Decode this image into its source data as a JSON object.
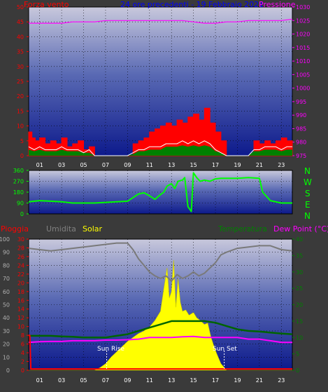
{
  "header": {
    "left_title": "Forza vento",
    "center_title": "24 ore precedenti - 19 Febbraio 2021",
    "right_title": "Pressione"
  },
  "middle": {
    "direction_letters": [
      "N",
      "W",
      "S",
      "E",
      "N"
    ]
  },
  "bottom_header": {
    "pioggia": "Pioggia",
    "umidita": "Umidita",
    "solar": "Solar",
    "temperatura": "Temperatura",
    "dew_point": "Dew Point (°C)"
  },
  "annotations": {
    "sun_rise": "Sun Rise",
    "sun_set": "Sun Set"
  },
  "colors": {
    "wind": "#ff0000",
    "gust": "#008000",
    "pressure": "#ff00ff",
    "direction": "#00ff00",
    "humidity": "#808080",
    "solar": "#ffff00",
    "temperature": "#006400",
    "dew_point": "#ff00ff",
    "rain": "#ff0000",
    "title_blue": "#0000ff",
    "green_label": "#008000"
  },
  "chart_data": [
    {
      "type": "line",
      "title": "24 ore precedenti - 19 Febbraio 2021",
      "x_ticks": [
        "01",
        "03",
        "05",
        "07",
        "09",
        "11",
        "13",
        "15",
        "17",
        "19",
        "21",
        "23"
      ],
      "xlim": [
        0,
        24
      ],
      "left_axis": {
        "label": "Forza vento",
        "ticks": [
          0,
          5,
          10,
          15,
          20,
          25,
          30,
          35,
          40,
          45,
          50
        ],
        "ylim": [
          0,
          50
        ]
      },
      "right_axis": {
        "label": "Pressione",
        "ticks": [
          975,
          980,
          985,
          990,
          995,
          1000,
          1005,
          1010,
          1015,
          1020,
          1025,
          1030
        ],
        "ylim": [
          975,
          1030
        ]
      },
      "series": [
        {
          "name": "Pressione",
          "axis": "right",
          "x": [
            0,
            1,
            2,
            3,
            4,
            5,
            6,
            7,
            8,
            9,
            10,
            11,
            12,
            13,
            14,
            15,
            16,
            17,
            18,
            19,
            20,
            21,
            22,
            23,
            24
          ],
          "y": [
            1024,
            1024,
            1024,
            1024,
            1024.5,
            1024.5,
            1024.5,
            1025,
            1025,
            1025,
            1025,
            1025,
            1025,
            1025,
            1025,
            1024.5,
            1024,
            1024,
            1024.5,
            1024.5,
            1025,
            1025,
            1025,
            1025,
            1025.5
          ]
        },
        {
          "name": "wind_max",
          "axis": "left",
          "x": [
            0,
            0.3,
            0.6,
            1,
            1.5,
            2,
            2.5,
            3,
            3.5,
            4,
            4.5,
            5,
            5.5,
            6,
            7,
            8,
            8.5,
            9,
            9.5,
            10,
            10.5,
            11,
            11.5,
            12,
            12.5,
            13,
            13.5,
            14,
            14.5,
            15,
            15.5,
            16,
            16.5,
            17,
            17.5,
            18,
            18.5,
            19,
            20,
            20.5,
            21,
            21.5,
            22,
            22.5,
            23,
            23.5,
            24
          ],
          "y": [
            8,
            6,
            5,
            6,
            4,
            5,
            4,
            6,
            3,
            4,
            5,
            2,
            3,
            0,
            0,
            0,
            0,
            0,
            4,
            5,
            6,
            8,
            9,
            10,
            11,
            10,
            12,
            11,
            13,
            14,
            12,
            16,
            11,
            8,
            5,
            0,
            0,
            0,
            0,
            5,
            4,
            5,
            4,
            5,
            6,
            5,
            5
          ]
        },
        {
          "name": "wind_avg",
          "axis": "left",
          "x": [
            0,
            0.5,
            1,
            1.5,
            2,
            2.5,
            3,
            3.5,
            4,
            4.5,
            5,
            5.5,
            6,
            7,
            8,
            9,
            9.5,
            10,
            10.5,
            11,
            11.5,
            12,
            12.5,
            13,
            13.5,
            14,
            14.5,
            15,
            15.5,
            16,
            16.5,
            17,
            17.5,
            18,
            19,
            20,
            20.5,
            21,
            21.5,
            22,
            22.5,
            23,
            23.5,
            24
          ],
          "y": [
            3,
            2,
            3,
            2,
            2,
            2,
            3,
            2,
            2,
            2,
            1,
            2,
            0,
            0,
            0,
            0,
            1,
            2,
            2,
            3,
            3,
            3,
            4,
            4,
            4,
            5,
            4,
            5,
            4,
            5,
            4,
            2,
            1,
            0,
            0,
            0,
            2,
            2,
            3,
            3,
            3,
            2,
            3,
            3
          ]
        },
        {
          "name": "wind_gust_area",
          "axis": "left",
          "x": [
            0,
            0.5,
            1,
            1.5,
            2,
            2.5,
            3,
            3.5,
            4,
            4.5,
            5,
            5.5,
            6,
            7,
            8,
            9,
            9.5,
            10,
            10.5,
            11,
            11.5,
            12,
            12.5,
            13,
            13.5,
            14,
            14.5,
            15,
            15.5,
            16,
            16.5,
            17,
            17.5,
            18,
            19,
            20,
            20.5,
            21,
            21.5,
            22,
            22.5,
            23,
            23.5,
            24
          ],
          "y": [
            2,
            1.5,
            2,
            1.5,
            1.5,
            1.5,
            2,
            1.5,
            1.5,
            1.5,
            1,
            1,
            0,
            0,
            0,
            0,
            0.5,
            1.5,
            1.5,
            2,
            2,
            2,
            3,
            3,
            3,
            3.5,
            3,
            3.5,
            3,
            3.5,
            3,
            1.5,
            1,
            0,
            0,
            0,
            1.5,
            1.5,
            2,
            2,
            2,
            1.5,
            2,
            2
          ]
        }
      ]
    },
    {
      "type": "line",
      "title": "",
      "x_ticks": [],
      "xlim": [
        0,
        24
      ],
      "left_axis": {
        "label": "",
        "ticks": [
          0,
          90,
          180,
          270,
          360
        ],
        "ylim": [
          0,
          360
        ]
      },
      "right_axis": {
        "label": "",
        "ticks": [
          "N",
          "W",
          "S",
          "E",
          "N"
        ]
      },
      "series": [
        {
          "name": "direction",
          "axis": "left",
          "x": [
            0,
            1,
            2,
            3,
            4,
            5,
            6,
            7,
            8,
            9,
            10,
            10.5,
            11,
            11.5,
            12,
            12.3,
            12.6,
            13,
            13.3,
            13.6,
            14,
            14.2,
            14.5,
            14.8,
            15,
            15.3,
            15.6,
            16,
            16.5,
            17,
            17.5,
            18,
            19,
            20,
            21,
            21.3,
            22,
            23,
            24
          ],
          "y": [
            100,
            110,
            105,
            100,
            90,
            90,
            90,
            95,
            100,
            105,
            165,
            175,
            150,
            120,
            160,
            180,
            230,
            250,
            210,
            270,
            280,
            300,
            60,
            20,
            340,
            300,
            270,
            280,
            270,
            290,
            295,
            295,
            295,
            300,
            295,
            180,
            110,
            90,
            90
          ]
        }
      ]
    },
    {
      "type": "area",
      "title": "",
      "x_ticks": [
        "01",
        "03",
        "05",
        "07",
        "09",
        "11",
        "13",
        "15",
        "17",
        "19",
        "21",
        "23"
      ],
      "xlim": [
        0,
        24
      ],
      "left_axis": {
        "labels": [
          "Pioggia",
          "Umidita",
          "Solar"
        ],
        "ticks_humidity": [
          0,
          10,
          20,
          30,
          40,
          50,
          60,
          70,
          80,
          90,
          100
        ],
        "ticks_rain": [
          0,
          2,
          4,
          6,
          8,
          10,
          12,
          14,
          16,
          18,
          20,
          22,
          24,
          26,
          28,
          30
        ],
        "ylim_humidity": [
          0,
          100
        ],
        "ylim_rain": [
          0,
          30
        ]
      },
      "right_axis": {
        "labels": [
          "Temperatura",
          "Dew Point (°C)"
        ],
        "ticks": [
          0,
          5,
          10,
          15,
          20,
          25,
          30,
          35,
          40
        ],
        "ylim": [
          0,
          40
        ]
      },
      "series": [
        {
          "name": "Umidita",
          "axis": "humidity",
          "x": [
            0,
            1,
            2,
            3,
            4,
            5,
            6,
            7,
            8,
            9,
            9.5,
            10,
            10.5,
            11,
            11.5,
            12,
            12.5,
            13,
            13.5,
            14,
            14.5,
            15,
            15.5,
            16,
            16.5,
            17,
            17.5,
            18,
            19,
            20,
            21,
            22,
            23,
            24
          ],
          "y": [
            93,
            92,
            91,
            92,
            93,
            94,
            95,
            96,
            97,
            97,
            92,
            85,
            80,
            75,
            72,
            70,
            72,
            68,
            73,
            70,
            72,
            75,
            72,
            74,
            78,
            82,
            88,
            90,
            93,
            94,
            95,
            95,
            92,
            91
          ]
        },
        {
          "name": "Solar",
          "axis": "humidity",
          "x": [
            0,
            6,
            6.5,
            7,
            7.5,
            8,
            8.5,
            9,
            9.5,
            10,
            10.5,
            11,
            11.5,
            12,
            12.3,
            12.6,
            12.8,
            13,
            13.2,
            13.4,
            13.6,
            13.8,
            14,
            14.3,
            14.6,
            15,
            15.3,
            15.6,
            16,
            16.3,
            16.6,
            17,
            17.5,
            18,
            24
          ],
          "y": [
            0,
            0,
            2,
            5,
            10,
            14,
            18,
            22,
            25,
            28,
            30,
            33,
            38,
            45,
            62,
            78,
            55,
            60,
            84,
            48,
            70,
            52,
            45,
            46,
            42,
            44,
            40,
            38,
            35,
            36,
            25,
            15,
            5,
            0,
            0
          ]
        },
        {
          "name": "Temperatura",
          "axis": "right",
          "x": [
            0,
            1,
            2,
            3,
            4,
            5,
            6,
            7,
            8,
            9,
            10,
            11,
            12,
            13,
            14,
            15,
            16,
            17,
            18,
            19,
            20,
            21,
            22,
            23,
            24
          ],
          "y": [
            10.5,
            10.5,
            10.5,
            10.3,
            10.2,
            10,
            10,
            10,
            10.5,
            11,
            12,
            13,
            14,
            15,
            15,
            15,
            15,
            14.5,
            13.5,
            12.5,
            12,
            11.8,
            11.5,
            11.2,
            11
          ]
        },
        {
          "name": "Dew Point (°C)",
          "axis": "right",
          "x": [
            0,
            1,
            2,
            3,
            4,
            5,
            6,
            7,
            8,
            9,
            10,
            11,
            12,
            13,
            14,
            15,
            16,
            17,
            18,
            19,
            20,
            21,
            22,
            23,
            24
          ],
          "y": [
            8.5,
            8.7,
            8.8,
            8.8,
            9,
            9,
            9,
            9.2,
            9.2,
            9.3,
            9.5,
            10,
            10,
            10,
            10.2,
            10.3,
            10,
            10,
            10,
            10,
            9.5,
            9.5,
            9,
            8.5,
            8.5
          ]
        },
        {
          "name": "Pioggia",
          "axis": "rain",
          "x": [
            0,
            0.1,
            0.2,
            24
          ],
          "y": [
            8,
            8,
            0.3,
            0.3
          ]
        }
      ]
    }
  ]
}
